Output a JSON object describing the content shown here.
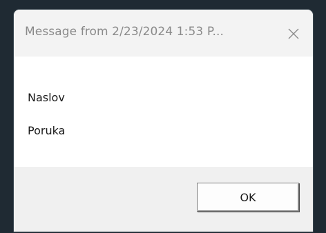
{
  "dialog": {
    "title": "Message from  2/23/2024 1:53 P...",
    "close_icon": "close-icon",
    "message_lines": [
      "Naslov",
      "Poruka"
    ],
    "ok_label": "OK"
  }
}
